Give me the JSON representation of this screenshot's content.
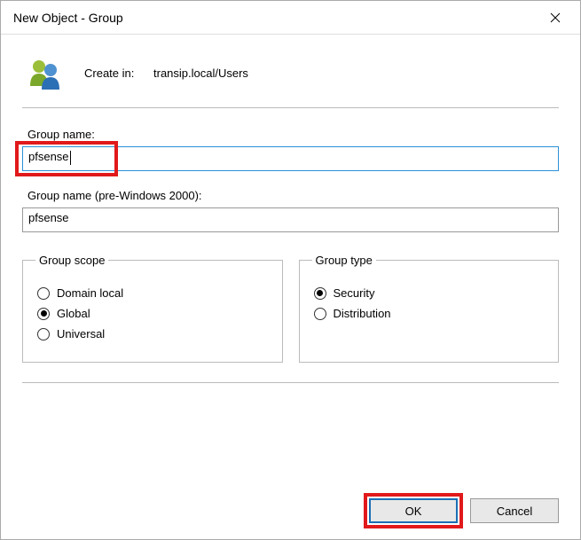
{
  "window": {
    "title": "New Object - Group"
  },
  "header": {
    "create_in_label": "Create in:",
    "create_in_path": "transip.local/Users"
  },
  "fields": {
    "group_name_label": "Group name:",
    "group_name_value": "pfsense",
    "group_name_pre2000_label": "Group name (pre-Windows 2000):",
    "group_name_pre2000_value": "pfsense"
  },
  "group_scope": {
    "legend": "Group scope",
    "options": {
      "domain_local": "Domain local",
      "global": "Global",
      "universal": "Universal"
    },
    "selected": "global"
  },
  "group_type": {
    "legend": "Group type",
    "options": {
      "security": "Security",
      "distribution": "Distribution"
    },
    "selected": "security"
  },
  "buttons": {
    "ok": "OK",
    "cancel": "Cancel"
  }
}
